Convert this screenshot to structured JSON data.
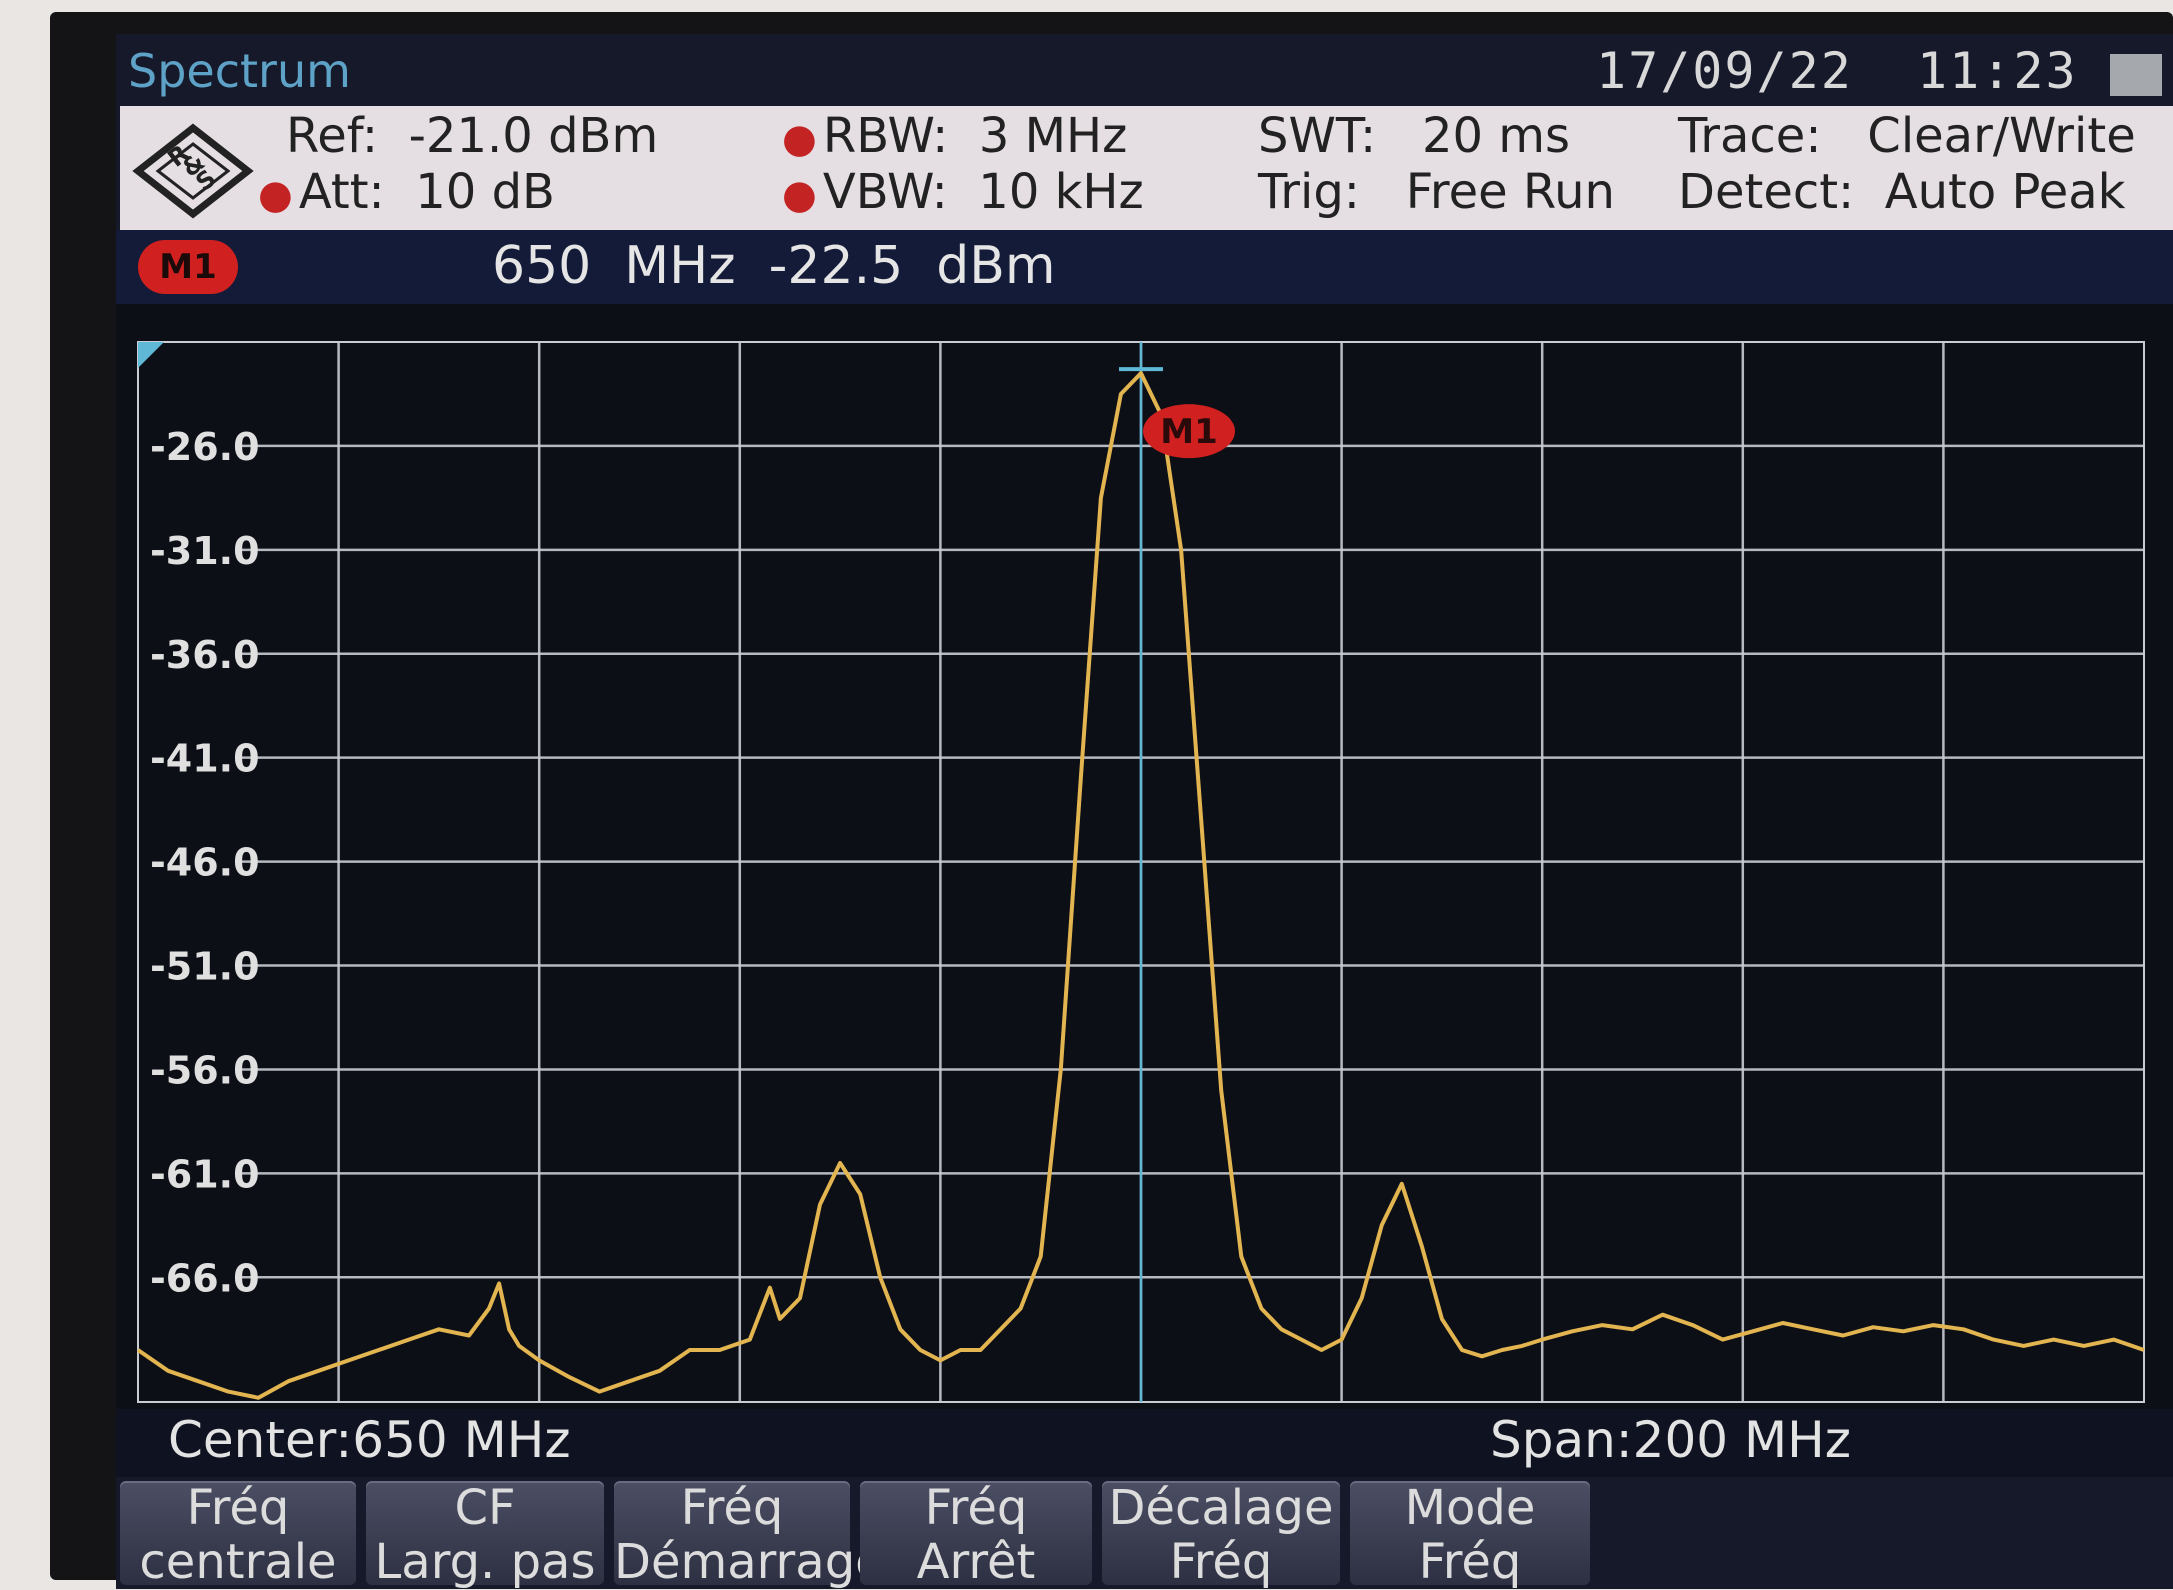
{
  "app": {
    "title": "Spectrum",
    "date": "17/09/22",
    "time": "11:23 ·"
  },
  "settings": {
    "ref": {
      "label": "Ref:",
      "value": "-21.0 dBm"
    },
    "att": {
      "label": "Att:",
      "value": "10 dB"
    },
    "rbw": {
      "label": "RBW:",
      "value": "3 MHz"
    },
    "vbw": {
      "label": "VBW:",
      "value": "10 kHz"
    },
    "swt": {
      "label": "SWT:",
      "value": "20 ms"
    },
    "trig": {
      "label": "Trig:",
      "value": "Free Run"
    },
    "trace": {
      "label": "Trace:",
      "value": "Clear/Write"
    },
    "detect": {
      "label": "Detect:",
      "value": "Auto Peak"
    }
  },
  "marker": {
    "name": "M1",
    "freq": "650  MHz",
    "level": "-22.5  dBm"
  },
  "footer": {
    "center": "Center:650 MHz",
    "span": "Span:200 MHz"
  },
  "softkeys": [
    {
      "line1": "Fréq",
      "line2": "centrale"
    },
    {
      "line1": "CF",
      "line2": "Larg. pas"
    },
    {
      "line1": "Fréq",
      "line2": "Démarrage"
    },
    {
      "line1": "Fréq",
      "line2": "Arrêt"
    },
    {
      "line1": "Décalage",
      "line2": "Fréq"
    },
    {
      "line1": "Mode",
      "line2": "Fréq"
    }
  ],
  "colors": {
    "trace": "#e2b550",
    "grid": "#c9ccd3",
    "marker_line": "#5fb8d6",
    "marker_badge": "#d0201f"
  },
  "chart_data": {
    "type": "line",
    "xlabel": "",
    "ylabel": "",
    "x_unit": "MHz",
    "y_unit": "dBm",
    "xlim": [
      550,
      750
    ],
    "ylim": [
      -72,
      -21
    ],
    "ytick_labels": [
      "-26.0",
      "-31.0",
      "-36.0",
      "-41.0",
      "-46.0",
      "-51.0",
      "-56.0",
      "-61.0",
      "-66.0"
    ],
    "ytick_values": [
      -26,
      -31,
      -36,
      -41,
      -46,
      -51,
      -56,
      -61,
      -66
    ],
    "grid": true,
    "marker": {
      "label": "M1",
      "x": 650,
      "y": -22.5
    },
    "series": [
      {
        "x": [
          550,
          553,
          556,
          559,
          562,
          565,
          568,
          571,
          574,
          577,
          580,
          583,
          585,
          586,
          587,
          588,
          590,
          593,
          596,
          599,
          602,
          605,
          608,
          611,
          613,
          614,
          616,
          618,
          620,
          622,
          624,
          626,
          628,
          630,
          632,
          634,
          636,
          638,
          640,
          642,
          644,
          646,
          648,
          650,
          652,
          654,
          656,
          658,
          660,
          662,
          664,
          666,
          668,
          670,
          672,
          674,
          676,
          678,
          680,
          682,
          684,
          686,
          688,
          690,
          693,
          696,
          699,
          702,
          705,
          708,
          711,
          714,
          717,
          720,
          723,
          726,
          729,
          732,
          735,
          738,
          741,
          744,
          747,
          750
        ],
        "y": [
          -69.5,
          -70.5,
          -71.0,
          -71.5,
          -71.8,
          -71.0,
          -70.5,
          -70.0,
          -69.5,
          -69.0,
          -68.5,
          -68.8,
          -67.5,
          -66.3,
          -68.5,
          -69.3,
          -70.0,
          -70.8,
          -71.5,
          -71.0,
          -70.5,
          -69.5,
          -69.5,
          -69.0,
          -66.5,
          -68.0,
          -67.0,
          -62.5,
          -60.5,
          -62.0,
          -66.0,
          -68.5,
          -69.5,
          -70.0,
          -69.5,
          -69.5,
          -68.5,
          -67.5,
          -65.0,
          -56.0,
          -42.0,
          -28.5,
          -23.5,
          -22.5,
          -24.5,
          -31.0,
          -44.0,
          -57.0,
          -65.0,
          -67.5,
          -68.5,
          -69.0,
          -69.5,
          -69.0,
          -67.0,
          -63.5,
          -61.5,
          -64.5,
          -68.0,
          -69.5,
          -69.8,
          -69.5,
          -69.3,
          -69.0,
          -68.6,
          -68.3,
          -68.5,
          -67.8,
          -68.3,
          -69.0,
          -68.6,
          -68.2,
          -68.5,
          -68.8,
          -68.4,
          -68.6,
          -68.3,
          -68.5,
          -69.0,
          -69.3,
          -69.0,
          -69.3,
          -69.0,
          -69.5
        ]
      }
    ]
  }
}
